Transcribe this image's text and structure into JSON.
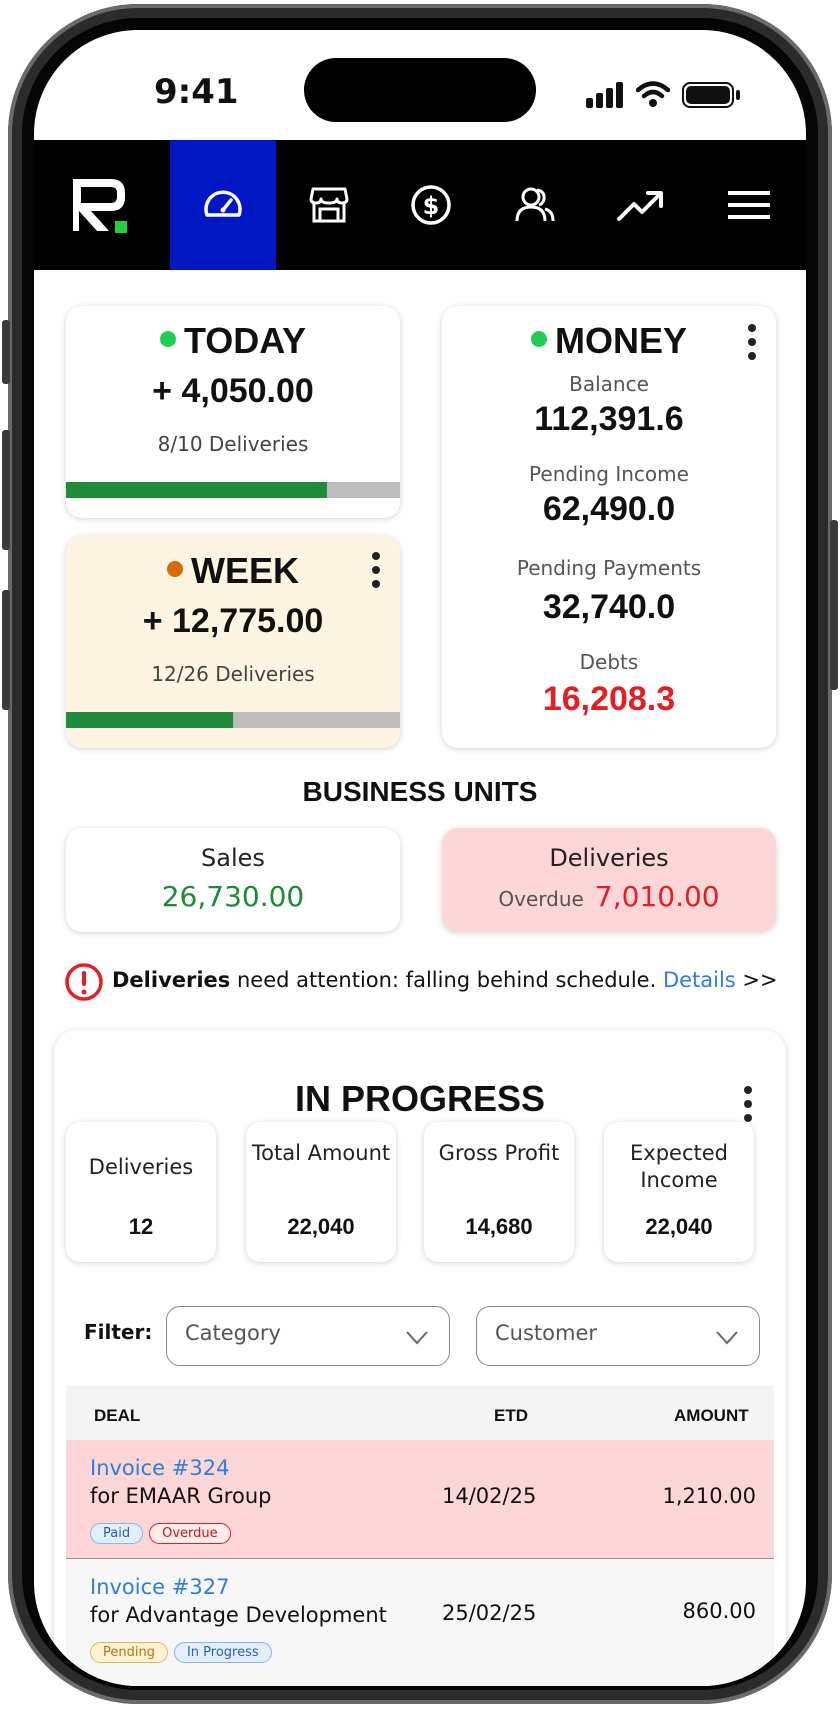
{
  "status_bar": {
    "time": "9:41"
  },
  "nav": {
    "items": [
      {
        "icon": "logo",
        "active": false
      },
      {
        "icon": "dashboard-gauge-icon",
        "active": true
      },
      {
        "icon": "store-icon",
        "active": false
      },
      {
        "icon": "dollar-icon",
        "active": false
      },
      {
        "icon": "users-icon",
        "active": false
      },
      {
        "icon": "trend-up-icon",
        "active": false
      },
      {
        "icon": "menu-icon",
        "active": false
      }
    ],
    "active_color": "#0018c4"
  },
  "today": {
    "title": "TODAY",
    "amount": "+ 4,050.00",
    "deliveries": "8/10 Deliveries",
    "progress": 0.78,
    "dot_color": "#22cc55"
  },
  "week": {
    "title": "WEEK",
    "amount": "+ 12,775.00",
    "deliveries": "12/26 Deliveries",
    "progress": 0.5,
    "dot_color": "#d86a0b"
  },
  "money": {
    "title": "MONEY",
    "balance_label": "Balance",
    "balance": "112,391.6",
    "pending_income_label": "Pending Income",
    "pending_income": "62,490.0",
    "pending_payments_label": "Pending Payments",
    "pending_payments": "32,740.0",
    "debts_label": "Debts",
    "debts": "16,208.3",
    "debts_color": "#e31e24"
  },
  "business_units": {
    "heading": "BUSINESS UNITS",
    "sales_label": "Sales",
    "sales_value": "26,730.00",
    "deliveries_label": "Deliveries",
    "overdue_label": "Overdue",
    "overdue_value": "7,010.00"
  },
  "alert": {
    "bold": "Deliveries",
    "text": " need attention: falling behind schedule. ",
    "link": "Details",
    "suffix": " >>"
  },
  "in_progress": {
    "heading": "IN PROGRESS",
    "stats": [
      {
        "label": "Deliveries",
        "value": "12"
      },
      {
        "label": "Total Amount",
        "value": "22,040"
      },
      {
        "label": "Gross Profit",
        "value": "14,680"
      },
      {
        "label": "Expected Income",
        "value": "22,040"
      }
    ],
    "filter_label": "Filter:",
    "category_placeholder": "Category",
    "customer_placeholder": "Customer"
  },
  "table": {
    "headers": {
      "deal": "DEAL",
      "etd": "ETD",
      "amount": "AMOUNT"
    },
    "rows": [
      {
        "invoice": "Invoice #324",
        "customer": "for EMAAR Group",
        "etd": "14/02/25",
        "amount": "1,210.00",
        "badge1": "Paid",
        "badge2": "Overdue"
      },
      {
        "invoice": "Invoice #327",
        "customer": "for Advantage Development",
        "etd": "25/02/25",
        "amount": "860.00",
        "badge1": "Pending",
        "badge2": "In Progress"
      }
    ]
  }
}
